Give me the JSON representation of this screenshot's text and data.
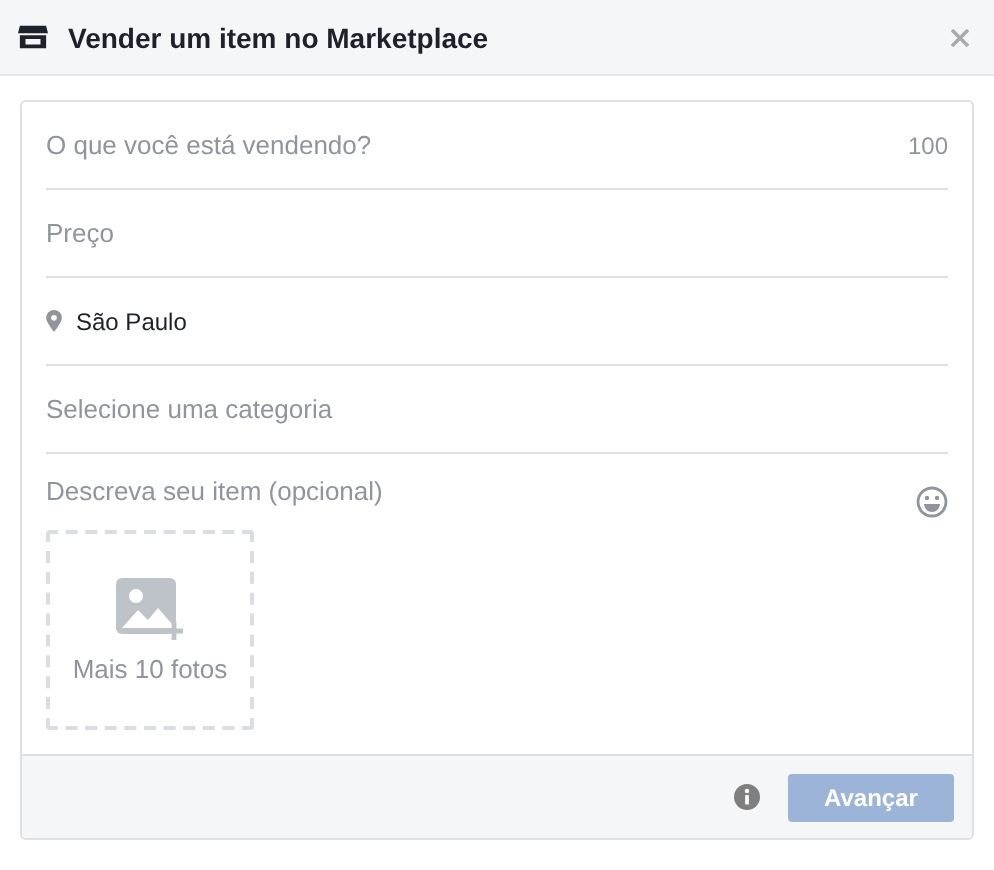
{
  "window": {
    "title": "Vender um item no Marketplace"
  },
  "fields": [
    {
      "kind": "text",
      "placeholder": "O que você está vendendo?",
      "counter": "100"
    },
    {
      "kind": "text",
      "placeholder": "Preço"
    },
    {
      "kind": "location",
      "value": "São Paulo"
    },
    {
      "kind": "select",
      "placeholder": "Selecione uma categoria"
    },
    {
      "kind": "description",
      "placeholder": "Descreva seu item (opcional)"
    }
  ],
  "photo_upload": {
    "label": "Mais 10 fotos"
  },
  "footer": {
    "button": {
      "label": "Avançar",
      "disabled": true
    }
  }
}
